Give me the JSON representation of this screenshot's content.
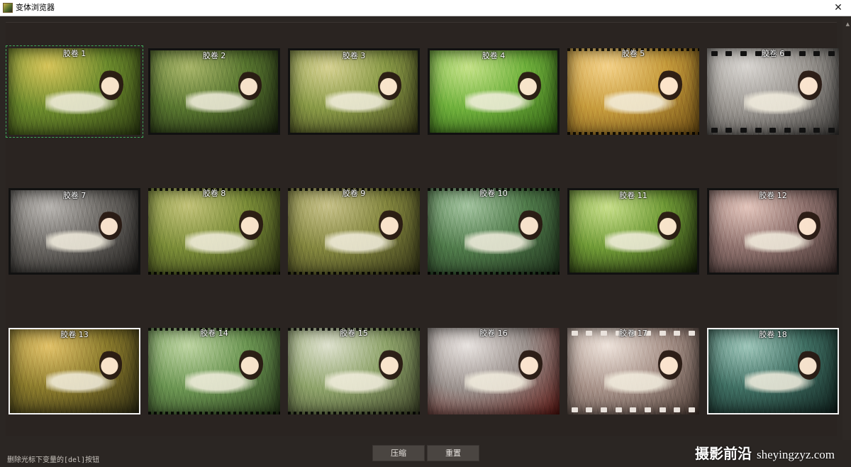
{
  "window": {
    "title": "变体浏览器",
    "close_glyph": "✕"
  },
  "thumbnails": [
    {
      "label": "胶卷 1",
      "c1": "#d7c55a",
      "c2": "#6b8a2c",
      "c3": "#2c3a12",
      "border": "none",
      "selected": true
    },
    {
      "label": "胶卷 2",
      "c1": "#a9b66a",
      "c2": "#57752f",
      "c3": "#1b2410",
      "border": "black"
    },
    {
      "label": "胶卷 3",
      "c1": "#d8d394",
      "c2": "#889946",
      "c3": "#3a3a18",
      "border": "black"
    },
    {
      "label": "胶卷 4",
      "c1": "#c6e38a",
      "c2": "#6fb13c",
      "c3": "#2d5a12",
      "border": "black"
    },
    {
      "label": "胶卷 5",
      "c1": "#f4d28a",
      "c2": "#c69b3c",
      "c3": "#6a4a12",
      "border": "dots"
    },
    {
      "label": "胶卷 6",
      "c1": "#d9d6d2",
      "c2": "#9b9792",
      "c3": "#3a3836",
      "border": "holes"
    },
    {
      "label": "胶卷 7",
      "c1": "#b9b6b2",
      "c2": "#6a6763",
      "c3": "#1f1d1b",
      "border": "black"
    },
    {
      "label": "胶卷 8",
      "c1": "#c3c37a",
      "c2": "#798b37",
      "c3": "#2a3112",
      "border": "dots"
    },
    {
      "label": "胶卷 9",
      "c1": "#c8c28a",
      "c2": "#82853e",
      "c3": "#303015",
      "border": "dots"
    },
    {
      "label": "胶卷 10",
      "c1": "#a3c4a0",
      "c2": "#4f7a4a",
      "c3": "#1c2e1a",
      "border": "dots"
    },
    {
      "label": "胶卷 11",
      "c1": "#c9e08c",
      "c2": "#6f9a36",
      "c3": "#151e08",
      "border": "black"
    },
    {
      "label": "胶卷 12",
      "c1": "#e4c6bd",
      "c2": "#8e716d",
      "c3": "#3a2c2a",
      "border": "black"
    },
    {
      "label": "胶卷 13",
      "c1": "#e3c36a",
      "c2": "#8a7a2c",
      "c3": "#2c2a12",
      "border": "white"
    },
    {
      "label": "胶卷 14",
      "c1": "#bfd6a4",
      "c2": "#6b9552",
      "c3": "#26381a",
      "border": "dots"
    },
    {
      "label": "胶卷 15",
      "c1": "#dfe2cf",
      "c2": "#8ea36a",
      "c3": "#3a4026",
      "border": "dots"
    },
    {
      "label": "胶卷 16",
      "c1": "#e9e4e1",
      "c2": "#9a918d",
      "c3": "#5a1410",
      "border": "red"
    },
    {
      "label": "胶卷 17",
      "c1": "#efe4dc",
      "c2": "#a8938a",
      "c3": "#4a3a33",
      "border": "holes-light"
    },
    {
      "label": "胶卷 18",
      "c1": "#9fc7bb",
      "c2": "#3f6e62",
      "c3": "#0e1f1c",
      "border": "white"
    }
  ],
  "footer": {
    "status": "删除光标下变量的[del]按钮",
    "compress_label": "压缩",
    "reset_label": "重置"
  },
  "watermark": {
    "cn": "摄影前沿",
    "url": "sheyingzyz.com"
  }
}
